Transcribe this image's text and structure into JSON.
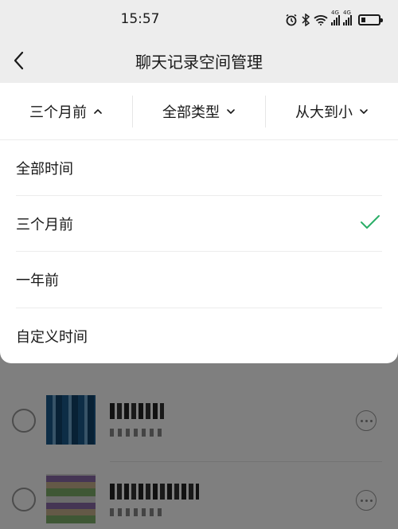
{
  "status_bar": {
    "time": "15:57",
    "icons": [
      "alarm-icon",
      "bluetooth-icon",
      "wifi-icon",
      "signal-4g-icon",
      "signal-4g-icon",
      "battery-icon"
    ],
    "signal_label": "4G"
  },
  "nav": {
    "title": "聊天记录空间管理",
    "back_icon": "chevron-left-icon"
  },
  "filters": [
    {
      "label": "三个月前",
      "icon": "chevron-up-icon",
      "expanded": true
    },
    {
      "label": "全部类型",
      "icon": "chevron-down-icon",
      "expanded": false
    },
    {
      "label": "从大到小",
      "icon": "chevron-down-icon",
      "expanded": false
    }
  ],
  "time_options": [
    {
      "label": "全部时间",
      "selected": false
    },
    {
      "label": "三个月前",
      "selected": true
    },
    {
      "label": "一年前",
      "selected": false
    },
    {
      "label": "自定义时间",
      "selected": false
    }
  ],
  "colors": {
    "accent_check": "#2aae67",
    "page_bg": "#ededed",
    "overlay": "rgba(0,0,0,0.5)"
  }
}
